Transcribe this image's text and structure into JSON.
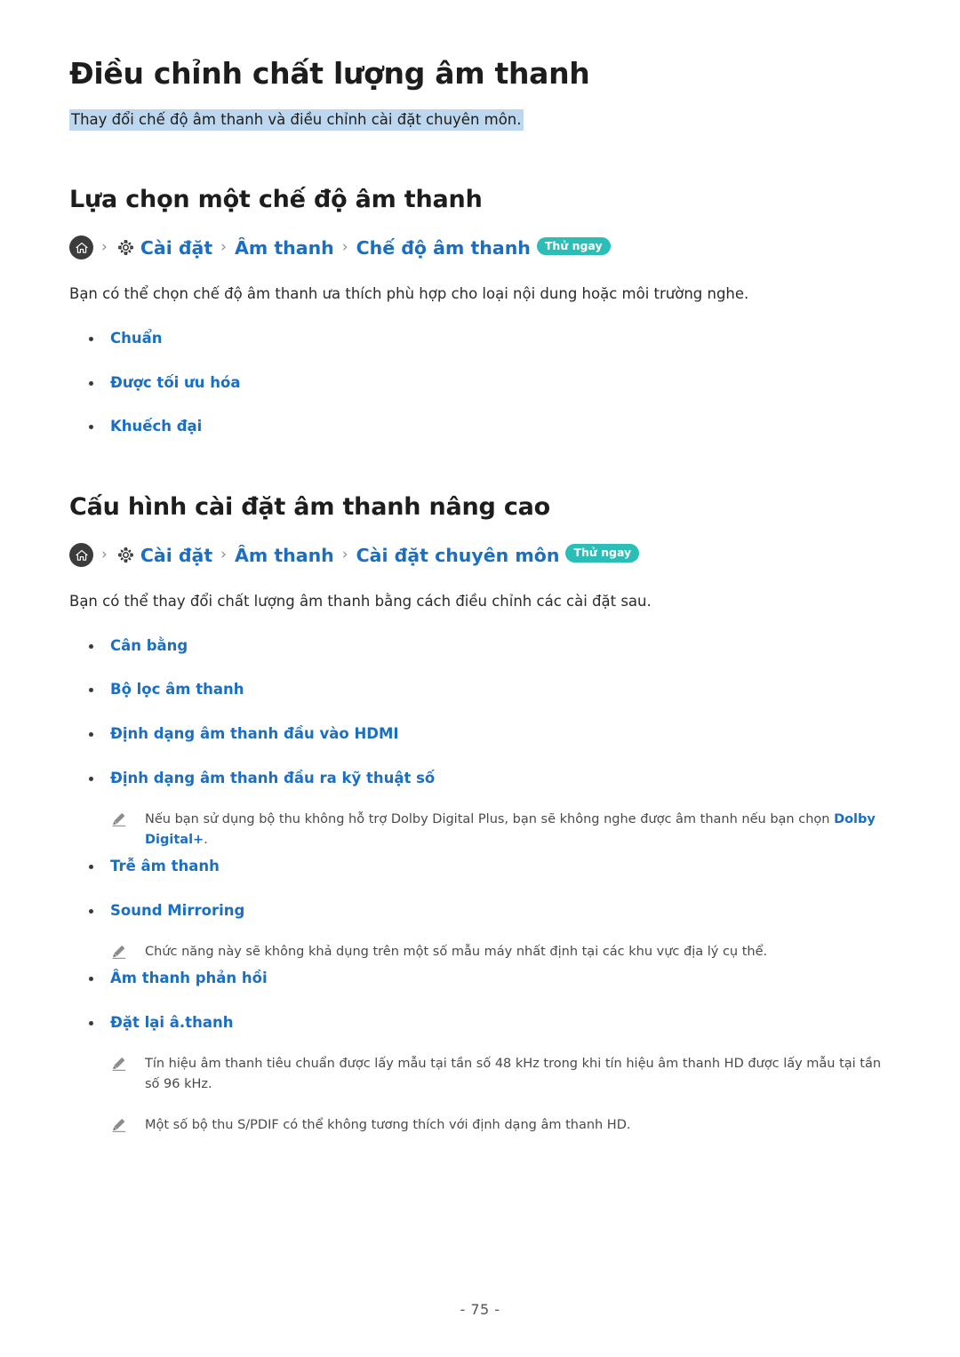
{
  "document": {
    "title": "Điều chỉnh chất lượng âm thanh",
    "subtitle": "Thay đổi chế độ âm thanh và điều chỉnh cài đặt chuyên môn.",
    "page_number": "- 75 -"
  },
  "colors": {
    "link_blue": "#1a6fc4",
    "badge_teal": "#2bbdb6",
    "highlight_blue": "#bdd7ee",
    "home_icon_bg": "#3c3c3c",
    "body_text": "#2b2b2b",
    "note_text": "#4a4a4a"
  },
  "icons": {
    "home": "home-icon",
    "gear": "gear-icon",
    "chevron": "chevron-right-icon",
    "note": "pencil-icon"
  },
  "sections": [
    {
      "heading": "Lựa chọn một chế độ âm thanh",
      "breadcrumb": {
        "home": "",
        "separator": "›",
        "items": [
          "Cài đặt",
          "Âm thanh",
          "Chế độ âm thanh"
        ],
        "badge": "Thử ngay"
      },
      "paragraph": "Bạn có thể chọn chế độ âm thanh ưa thích phù hợp cho loại nội dung hoặc môi trường nghe.",
      "bullets": [
        {
          "label": "Chuẩn"
        },
        {
          "label": "Được tối ưu hóa"
        },
        {
          "label": "Khuếch đại"
        }
      ]
    },
    {
      "heading": "Cấu hình cài đặt âm thanh nâng cao",
      "breadcrumb": {
        "home": "",
        "separator": "›",
        "items": [
          "Cài đặt",
          "Âm thanh",
          "Cài đặt chuyên môn"
        ],
        "badge": "Thử ngay"
      },
      "paragraph": "Bạn có thể thay đổi chất lượng âm thanh bằng cách điều chỉnh các cài đặt sau.",
      "bullets": [
        {
          "label": "Cân bằng"
        },
        {
          "label": "Bộ lọc âm thanh"
        },
        {
          "label": "Định dạng âm thanh đầu vào HDMI"
        },
        {
          "label": "Định dạng âm thanh đầu ra kỹ thuật số"
        },
        {
          "label": "Trễ âm thanh"
        },
        {
          "label": "Sound Mirroring"
        },
        {
          "label": "Âm thanh phản hồi"
        },
        {
          "label": "Đặt lại â.thanh"
        }
      ]
    }
  ],
  "notes": {
    "dolby": {
      "text_before": "Nếu bạn sử dụng bộ thu không hỗ trợ Dolby Digital Plus, bạn sẽ không nghe được âm thanh nếu bạn chọn ",
      "emphasis": "Dolby Digital+",
      "text_after": "."
    },
    "mirroring": "Chức năng này sẽ không khả dụng trên một số mẫu máy nhất định tại các khu vực địa lý cụ thể.",
    "sampling": "Tín hiệu âm thanh tiêu chuẩn được lấy mẫu tại tần số 48 kHz trong khi tín hiệu âm thanh HD được lấy mẫu tại tần số 96 kHz.",
    "spdif": "Một số bộ thu S/PDIF có thể không tương thích với định dạng âm thanh HD."
  }
}
